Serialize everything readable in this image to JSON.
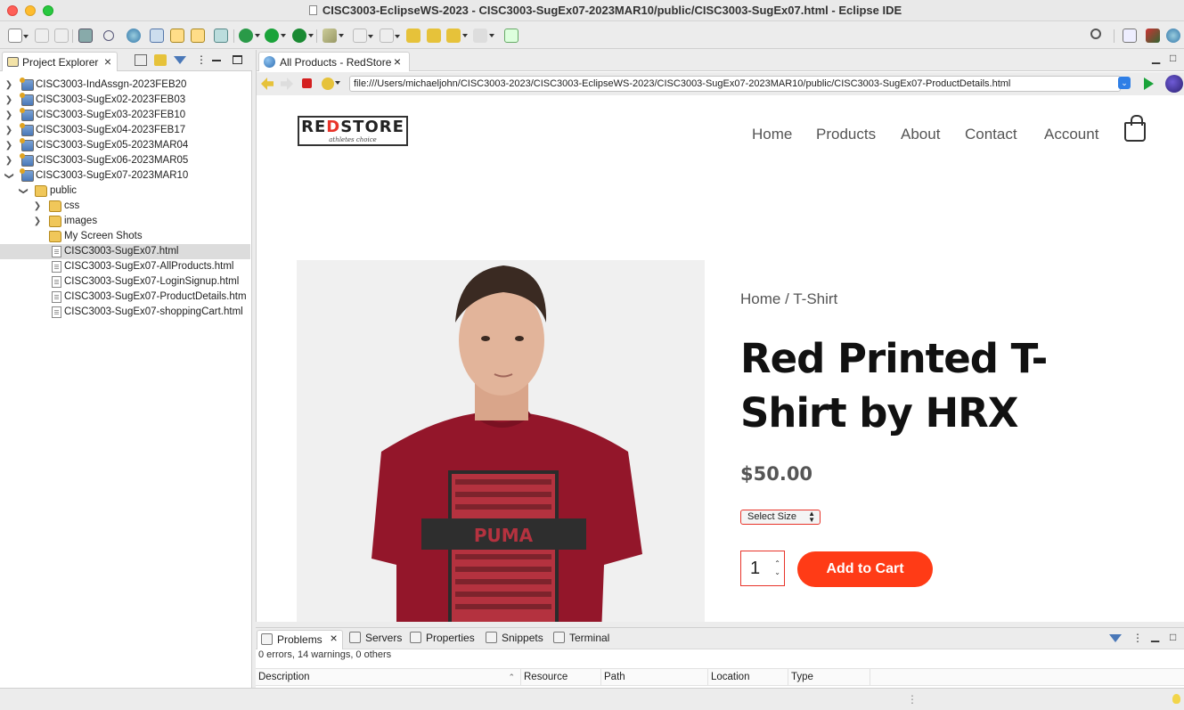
{
  "window": {
    "title": "CISC3003-EclipseWS-2023 - CISC3003-SugEx07-2023MAR10/public/CISC3003-SugEx07.html - Eclipse IDE"
  },
  "project_explorer": {
    "tab_label": "Project Explorer",
    "items": [
      {
        "label": "CISC3003-IndAssgn-2023FEB20"
      },
      {
        "label": "CISC3003-SugEx02-2023FEB03"
      },
      {
        "label": "CISC3003-SugEx03-2023FEB10"
      },
      {
        "label": "CISC3003-SugEx04-2023FEB17"
      },
      {
        "label": "CISC3003-SugEx05-2023MAR04"
      },
      {
        "label": "CISC3003-SugEx06-2023MAR05"
      },
      {
        "label": "CISC3003-SugEx07-2023MAR10"
      },
      {
        "label": "public"
      },
      {
        "label": "css"
      },
      {
        "label": "images"
      },
      {
        "label": "My Screen Shots"
      },
      {
        "label": "CISC3003-SugEx07.html"
      },
      {
        "label": "CISC3003-SugEx07-AllProducts.html"
      },
      {
        "label": "CISC3003-SugEx07-LoginSignup.html"
      },
      {
        "label": "CISC3003-SugEx07-ProductDetails.htm"
      },
      {
        "label": "CISC3003-SugEx07-shoppingCart.html"
      }
    ]
  },
  "editor": {
    "tab_label": "All Products - RedStore",
    "url": "file:///Users/michaeljohn/CISC3003-2023/CISC3003-EclipseWS-2023/CISC3003-SugEx07-2023MAR10/public/CISC3003-SugEx07-ProductDetails.html"
  },
  "site": {
    "logo": {
      "brand_a": "RE",
      "brand_b": "D",
      "brand_c": "STORE",
      "tagline": "athletes choice"
    },
    "nav": [
      "Home",
      "Products",
      "About",
      "Contact",
      "Account"
    ],
    "breadcrumb": "Home / T-Shirt",
    "product_title": "Red Printed T-Shirt by HRX",
    "price": "$50.00",
    "size_select": "Select Size",
    "quantity": "1",
    "add_to_cart": "Add to Cart",
    "shirt_print": "PUMA"
  },
  "bottom_panel": {
    "tabs": [
      "Problems",
      "Servers",
      "Properties",
      "Snippets",
      "Terminal"
    ],
    "summary": "0 errors, 14 warnings, 0 others",
    "columns": [
      "Description",
      "Resource",
      "Path",
      "Location",
      "Type"
    ]
  },
  "colors": {
    "accent": "#ff3b16",
    "brand_red": "#e8342a"
  }
}
